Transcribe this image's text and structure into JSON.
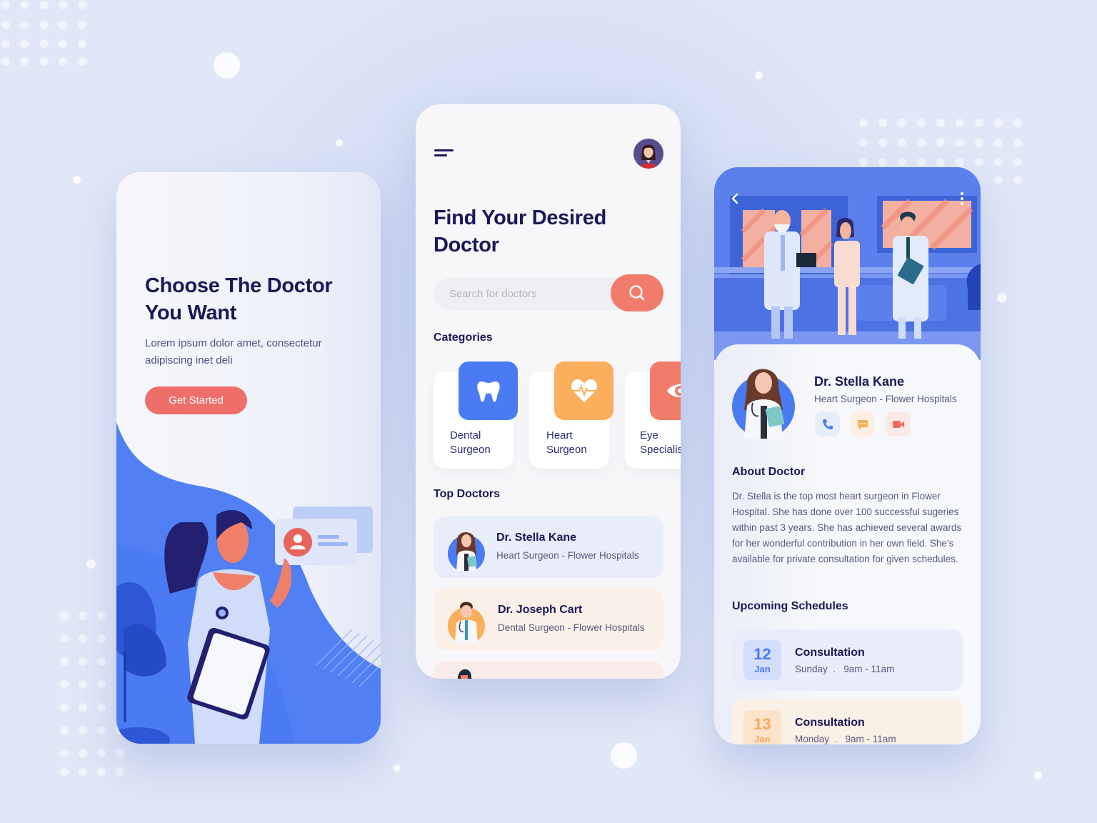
{
  "onboarding": {
    "title_line1": "Choose The Doctor",
    "title_line2": "You Want",
    "subtitle": "Lorem ipsum dolor amet, consectetur adipiscing inet deli",
    "cta_label": "Get Started"
  },
  "home": {
    "menu_icon": "hamburger-menu-icon",
    "avatar": "user-avatar",
    "title_line1": "Find Your Desired",
    "title_line2": "Doctor",
    "search": {
      "placeholder": "Search for doctors",
      "value": "",
      "icon": "search-icon"
    },
    "categories_label": "Categories",
    "categories": [
      {
        "label": "Dental\nSurgeon",
        "icon": "tooth-icon",
        "color": "#4a7bf2"
      },
      {
        "label": "Heart\nSurgeon",
        "icon": "heart-pulse-icon",
        "color": "#fbae5c"
      },
      {
        "label": "Eye\nSpecialist",
        "icon": "eye-icon",
        "color": "#f27c6c"
      }
    ],
    "top_doctors_label": "Top Doctors",
    "top_doctors": [
      {
        "name": "Dr. Stella Kane",
        "specialty": "Heart Surgeon - Flower Hospitals",
        "bg": "#e8edf9",
        "accent": "#4a7bf2"
      },
      {
        "name": "Dr. Joseph Cart",
        "specialty": "Dental Surgeon - Flower Hospitals",
        "bg": "#fbf0e8",
        "accent": "#fbae5c"
      },
      {
        "name": "",
        "specialty": "",
        "bg": "#f9ebe9",
        "accent": "#f27c6c"
      }
    ]
  },
  "detail": {
    "back_icon": "chevron-left-icon",
    "more_icon": "more-vertical-icon",
    "name": "Dr. Stella Kane",
    "specialty": "Heart Surgeon - Flower Hospitals",
    "actions": [
      {
        "icon": "phone-icon",
        "bg": "#e6edfb",
        "color": "#4a7bf2"
      },
      {
        "icon": "chat-icon",
        "bg": "#fcefe4",
        "color": "#fbae5c"
      },
      {
        "icon": "video-icon",
        "bg": "#fbe9e7",
        "color": "#f06a5e"
      }
    ],
    "about_title": "About Doctor",
    "about_text": "Dr. Stella is the top most heart surgeon in Flower Hospital. She has done over 100 successful sugeries within past 3 years. She has achieved several awards for her wonderful contribution in her own field. She's available for private consultation for given schedules.",
    "schedules_title": "Upcoming Schedules",
    "schedules": [
      {
        "day": "12",
        "month": "Jan",
        "title": "Consultation",
        "time": "Sunday  .   9am - 11am",
        "bg": "#e8edf9",
        "date_bg": "#d3defb",
        "date_color": "#4a7bf2"
      },
      {
        "day": "13",
        "month": "Jan",
        "title": "Consultation",
        "time": "Monday  .   9am - 11am",
        "bg": "#fbf0e6",
        "date_bg": "#fbe3cc",
        "date_color": "#f5a95a"
      }
    ]
  },
  "colors": {
    "primary": "#4a7bf2",
    "accent": "#f27c6c",
    "orange": "#fbae5c",
    "navy": "#1a1857"
  }
}
